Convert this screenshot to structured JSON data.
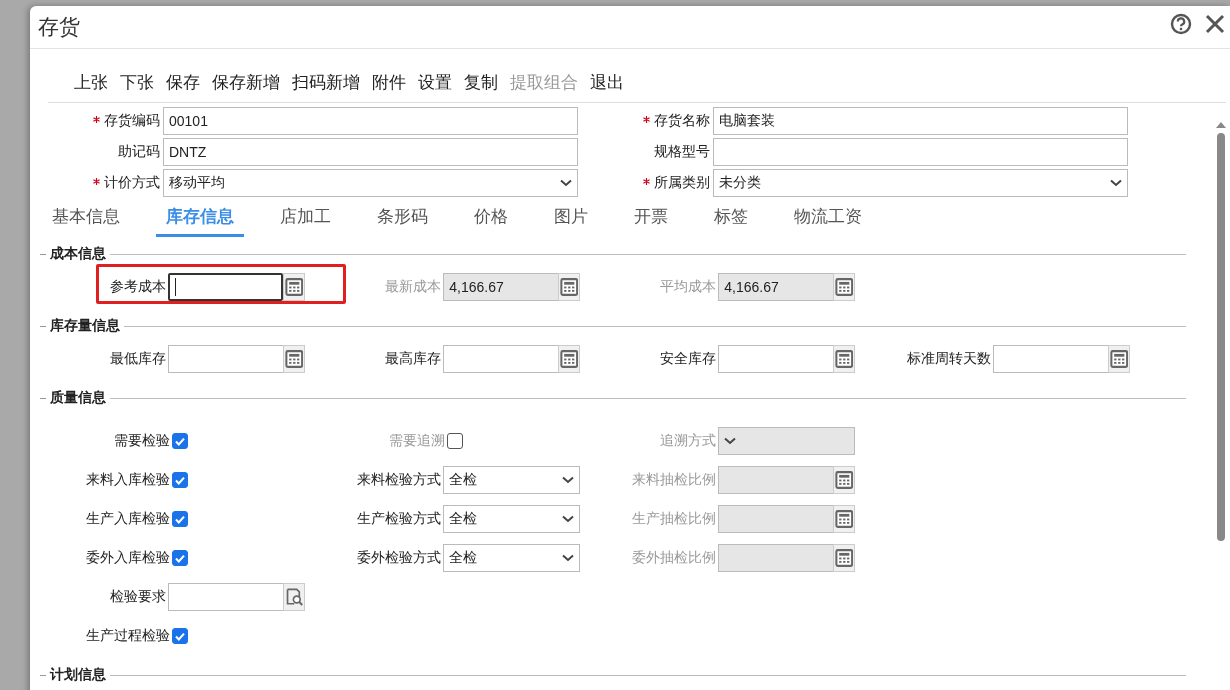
{
  "window": {
    "title": "存货"
  },
  "toolbar": [
    {
      "label": "上张",
      "disabled": false
    },
    {
      "label": "下张",
      "disabled": false
    },
    {
      "label": "保存",
      "disabled": false
    },
    {
      "label": "保存新增",
      "disabled": false
    },
    {
      "label": "扫码新增",
      "disabled": false
    },
    {
      "label": "附件",
      "disabled": false
    },
    {
      "label": "设置",
      "disabled": false
    },
    {
      "label": "复制",
      "disabled": false
    },
    {
      "label": "提取组合",
      "disabled": true
    },
    {
      "label": "退出",
      "disabled": false
    }
  ],
  "header_fields": [
    {
      "label": "存货编码",
      "required": true,
      "kind": "text",
      "value": "00101"
    },
    {
      "label": "存货名称",
      "required": true,
      "kind": "text",
      "value": "电脑套装"
    },
    {
      "label": "助记码",
      "required": false,
      "kind": "text",
      "value": "DNTZ"
    },
    {
      "label": "规格型号",
      "required": false,
      "kind": "text"
    },
    {
      "label": "计价方式",
      "required": true,
      "kind": "select",
      "value": "移动平均"
    },
    {
      "label": "所属类别",
      "required": true,
      "kind": "select",
      "value": "未分类"
    }
  ],
  "tabs": [
    {
      "label": "基本信息",
      "selected": false
    },
    {
      "label": "库存信息",
      "selected": true
    },
    {
      "label": "店加工",
      "selected": false
    },
    {
      "label": "条形码",
      "selected": false
    },
    {
      "label": "价格",
      "selected": false
    },
    {
      "label": "图片",
      "selected": false
    },
    {
      "label": "开票",
      "selected": false
    },
    {
      "label": "标签",
      "selected": false
    },
    {
      "label": "物流工资",
      "selected": false
    }
  ],
  "sections": [
    {
      "title": "成本信息",
      "rows": [
        [
          {
            "label": "参考成本",
            "kind": "number",
            "disabled": false,
            "focused": true,
            "highlighted": true
          },
          {
            "label": "最新成本",
            "kind": "number",
            "value": "4,166.67",
            "disabled": true,
            "focused": false,
            "highlighted": false
          },
          {
            "label": "平均成本",
            "kind": "number",
            "value": "4,166.67",
            "disabled": true,
            "focused": false,
            "highlighted": false
          }
        ]
      ]
    },
    {
      "title": "库存量信息",
      "rows": [
        [
          {
            "label": "最低库存",
            "kind": "number",
            "disabled": false,
            "focused": false,
            "highlighted": false
          },
          {
            "label": "最高库存",
            "kind": "number",
            "disabled": false,
            "focused": false,
            "highlighted": false
          },
          {
            "label": "安全库存",
            "kind": "number",
            "disabled": false,
            "focused": false,
            "highlighted": false
          },
          {
            "label": "标准周转天数",
            "kind": "number",
            "disabled": false,
            "focused": false,
            "highlighted": false
          }
        ]
      ]
    },
    {
      "title": "质量信息",
      "rows": [
        [
          {
            "label": "需要检验",
            "kind": "checkbox",
            "checked": true,
            "disabled": false
          },
          {
            "label": "需要追溯",
            "kind": "checkbox",
            "checked": false,
            "disabled": true
          },
          {
            "label": "追溯方式",
            "kind": "select",
            "disabled": true
          }
        ],
        [
          {
            "label": "来料入库检验",
            "kind": "checkbox",
            "checked": true,
            "disabled": false
          },
          {
            "label": "来料检验方式",
            "kind": "select",
            "value": "全检",
            "disabled": false
          },
          {
            "label": "来料抽检比例",
            "kind": "number",
            "disabled": true
          }
        ],
        [
          {
            "label": "生产入库检验",
            "kind": "checkbox",
            "checked": true,
            "disabled": false
          },
          {
            "label": "生产检验方式",
            "kind": "select",
            "value": "全检",
            "disabled": false
          },
          {
            "label": "生产抽检比例",
            "kind": "number",
            "disabled": true
          }
        ],
        [
          {
            "label": "委外入库检验",
            "kind": "checkbox",
            "checked": true,
            "disabled": false
          },
          {
            "label": "委外检验方式",
            "kind": "select",
            "value": "全检",
            "disabled": false
          },
          {
            "label": "委外抽检比例",
            "kind": "number",
            "disabled": true
          }
        ],
        [
          {
            "label": "检验要求",
            "kind": "lookup",
            "disabled": false
          }
        ],
        [
          {
            "label": "生产过程检验",
            "kind": "checkbox",
            "checked": true,
            "disabled": false
          }
        ]
      ]
    },
    {
      "title": "计划信息"
    }
  ]
}
